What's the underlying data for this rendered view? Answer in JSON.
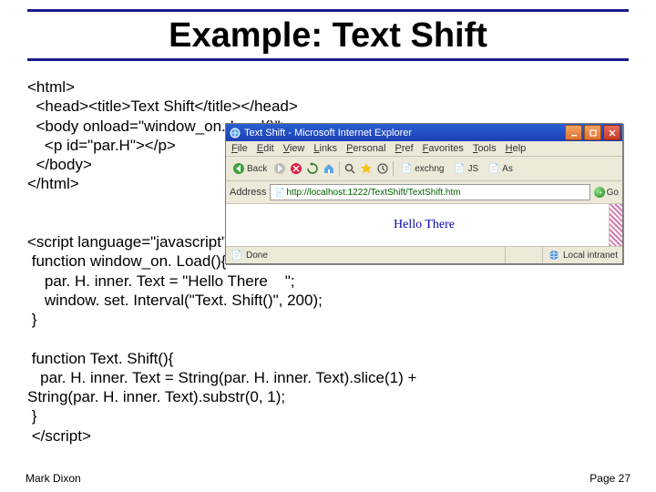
{
  "title": "Example: Text Shift",
  "code_block_1": "<html>\n  <head><title>Text Shift</title></head>\n  <body onload=\"window_on. Load()\">\n    <p id=\"par.H\"></p>\n  </body>\n</html>",
  "code_block_2": "<script language=\"javascript\">\n function window_on. Load(){\n    par. H. inner. Text = \"Hello There    \";\n    window. set. Interval(\"Text. Shift()\", 200);\n }\n\n function Text. Shift(){\n   par. H. inner. Text = String(par. H. inner. Text).slice(1) +\nString(par. H. inner. Text).substr(0, 1);\n }\n </script>",
  "footer": {
    "left": "Mark Dixon",
    "right": "Page 27"
  },
  "browser": {
    "title": "Text Shift - Microsoft Internet Explorer",
    "menu": [
      "File",
      "Edit",
      "View",
      "Links",
      "Personal",
      "Pref",
      "Favorites",
      "Tools",
      "Help"
    ],
    "toolbar": {
      "back": "Back",
      "links": [
        "exchng",
        "JS",
        "As"
      ]
    },
    "address": {
      "label": "Address",
      "value": "http://localhost:1222/TextShift/TextShift.htm",
      "go": "Go"
    },
    "page_text": "Hello There",
    "status": {
      "left": "Done",
      "right": "Local intranet"
    }
  }
}
